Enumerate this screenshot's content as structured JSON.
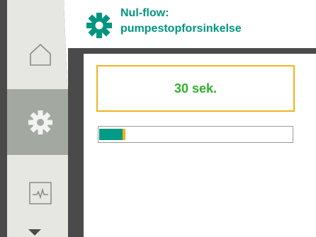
{
  "header": {
    "title_line1": "Nul-flow:",
    "title_line2": "pumpestopforsinkelse",
    "icon": "gear-icon"
  },
  "nav": {
    "items": [
      {
        "id": "home",
        "icon": "home-icon",
        "active": false
      },
      {
        "id": "settings",
        "icon": "gear-icon",
        "active": true
      },
      {
        "id": "diagnostics",
        "icon": "pulse-monitor-icon",
        "active": false
      }
    ],
    "more_indicator": "chevron-down-icon"
  },
  "setting": {
    "value_label": "30 sek.",
    "progress_fraction": 0.12
  },
  "colors": {
    "accent_green": "#00957e",
    "value_green": "#2eb02a",
    "focus_yellow": "#f2b31f",
    "rail_dark": "#4a4a4a",
    "rail_light": "#e6e6e3",
    "active_nav": "#a3a8a1"
  }
}
